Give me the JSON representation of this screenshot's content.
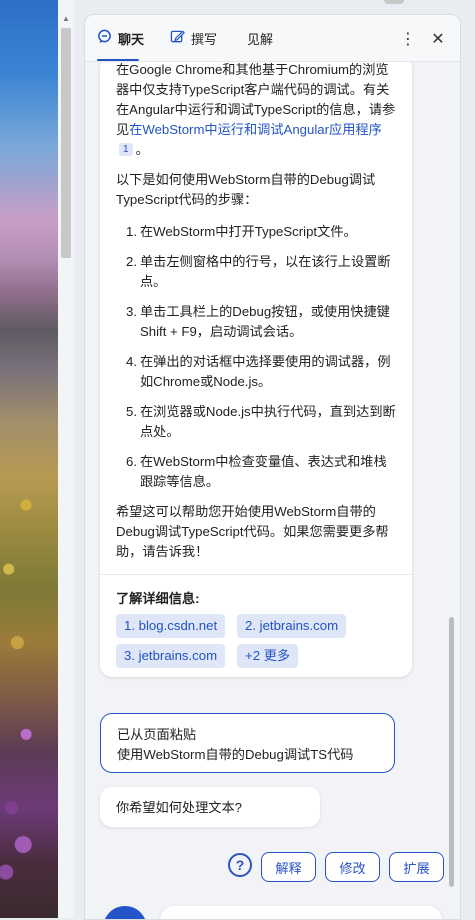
{
  "window": {
    "scroll_up_icon": "triangle-up"
  },
  "header": {
    "tabs": [
      {
        "label": "聊天",
        "icon": "chat-bubble-icon",
        "active": true
      },
      {
        "label": "撰写",
        "icon": "edit-pencil-icon",
        "active": false
      },
      {
        "label": "见解",
        "active": false
      }
    ],
    "more_icon": "⋮",
    "close_icon": "✕"
  },
  "answer": {
    "intro": "在Google Chrome和其他基于Chromium的浏览器中仅支持TypeScript客户端代码的调试。有关在Angular中运行和调试TypeScript的信息，请参见",
    "intro_link": "在WebStorm中运行和调试Angular应用程序",
    "intro_cite": "1",
    "intro_end": "。",
    "steps_intro": "以下是如何使用WebStorm自带的Debug调试TypeScript代码的步骤：",
    "steps": [
      {
        "num": "1.",
        "text": "在WebStorm中打开TypeScript文件。"
      },
      {
        "num": "2.",
        "text": "单击左侧窗格中的行号，以在该行上设置断点。"
      },
      {
        "num": "3.",
        "text": "单击工具栏上的Debug按钮，或使用快捷键Shift + F9，启动调试会话。"
      },
      {
        "num": "4.",
        "text": "在弹出的对话框中选择要使用的调试器，例如Chrome或Node.js。"
      },
      {
        "num": "5.",
        "text": "在浏览器或Node.js中执行代码，直到达到断点处。"
      },
      {
        "num": "6.",
        "text": "在WebStorm中检查变量值、表达式和堆栈跟踪等信息。"
      }
    ],
    "closing": "希望这可以帮助您开始使用WebStorm自带的Debug调试TypeScript代码。如果您需要更多帮助，请告诉我！",
    "learn_more_title": "了解详细信息:",
    "sources": [
      "1. blog.csdn.net",
      "2. jetbrains.com",
      "3. jetbrains.com",
      "+2 更多"
    ]
  },
  "user_message": {
    "line1": "已从页面粘贴",
    "line2": "使用WebStorm自带的Debug调试TS代码"
  },
  "assistant_question": "你希望如何处理文本?",
  "actions": {
    "help_icon": "?",
    "buttons": [
      "解释",
      "修改",
      "扩展"
    ]
  },
  "colors": {
    "accent": "#2a53c7",
    "chip_bg": "#dfe6f8",
    "panel_bg": "#f1f3f7"
  }
}
